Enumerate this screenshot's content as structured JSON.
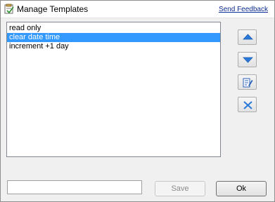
{
  "window": {
    "title": "Manage Templates",
    "feedback_link": "Send Feedback"
  },
  "templates": {
    "items": [
      "read only",
      "clear date time",
      "increment +1 day"
    ],
    "selected_index": 1
  },
  "side_buttons": {
    "move_up": "arrow-up-icon",
    "move_down": "arrow-down-icon",
    "edit": "edit-icon",
    "delete": "delete-icon"
  },
  "footer": {
    "name_value": "",
    "save_label": "Save",
    "ok_label": "Ok"
  },
  "colors": {
    "selection": "#3399ff",
    "link": "#0b2b8e",
    "arrow_blue": "#2a78d8"
  }
}
